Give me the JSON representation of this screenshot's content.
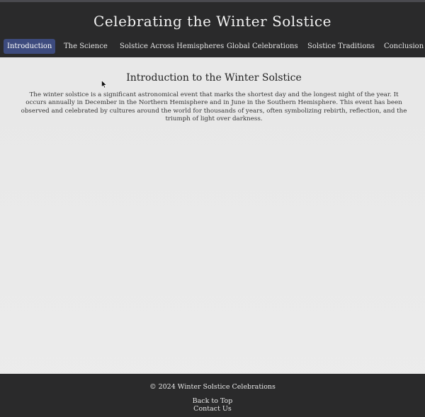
{
  "header": {
    "title": "Celebrating the Winter Solstice"
  },
  "nav": {
    "items": [
      {
        "label": "Introduction",
        "active": true
      },
      {
        "label": "The Science",
        "active": false
      },
      {
        "label": "Solstice Across Hemispheres",
        "active": false
      },
      {
        "label": "Global Celebrations",
        "active": false
      },
      {
        "label": "Solstice Traditions",
        "active": false
      },
      {
        "label": "Conclusion",
        "active": false
      }
    ]
  },
  "main": {
    "section_title": "Introduction to the Winter Solstice",
    "paragraph": "The winter solstice is a significant astronomical event that marks the shortest day and the longest night of the year. It occurs annually in December in the Northern Hemisphere and in June in the Southern Hemisphere. This event has been observed and celebrated by cultures around the world for thousands of years, often symbolizing rebirth, reflection, and the triumph of light over darkness."
  },
  "footer": {
    "copyright": "© 2024 Winter Solstice Celebrations",
    "back_to_top": "Back to Top",
    "contact_us": "Contact Us"
  },
  "colors": {
    "header_bg": "#2a2a2b",
    "active_tab": "#3d4b7e",
    "page_bg": "#ececec"
  }
}
